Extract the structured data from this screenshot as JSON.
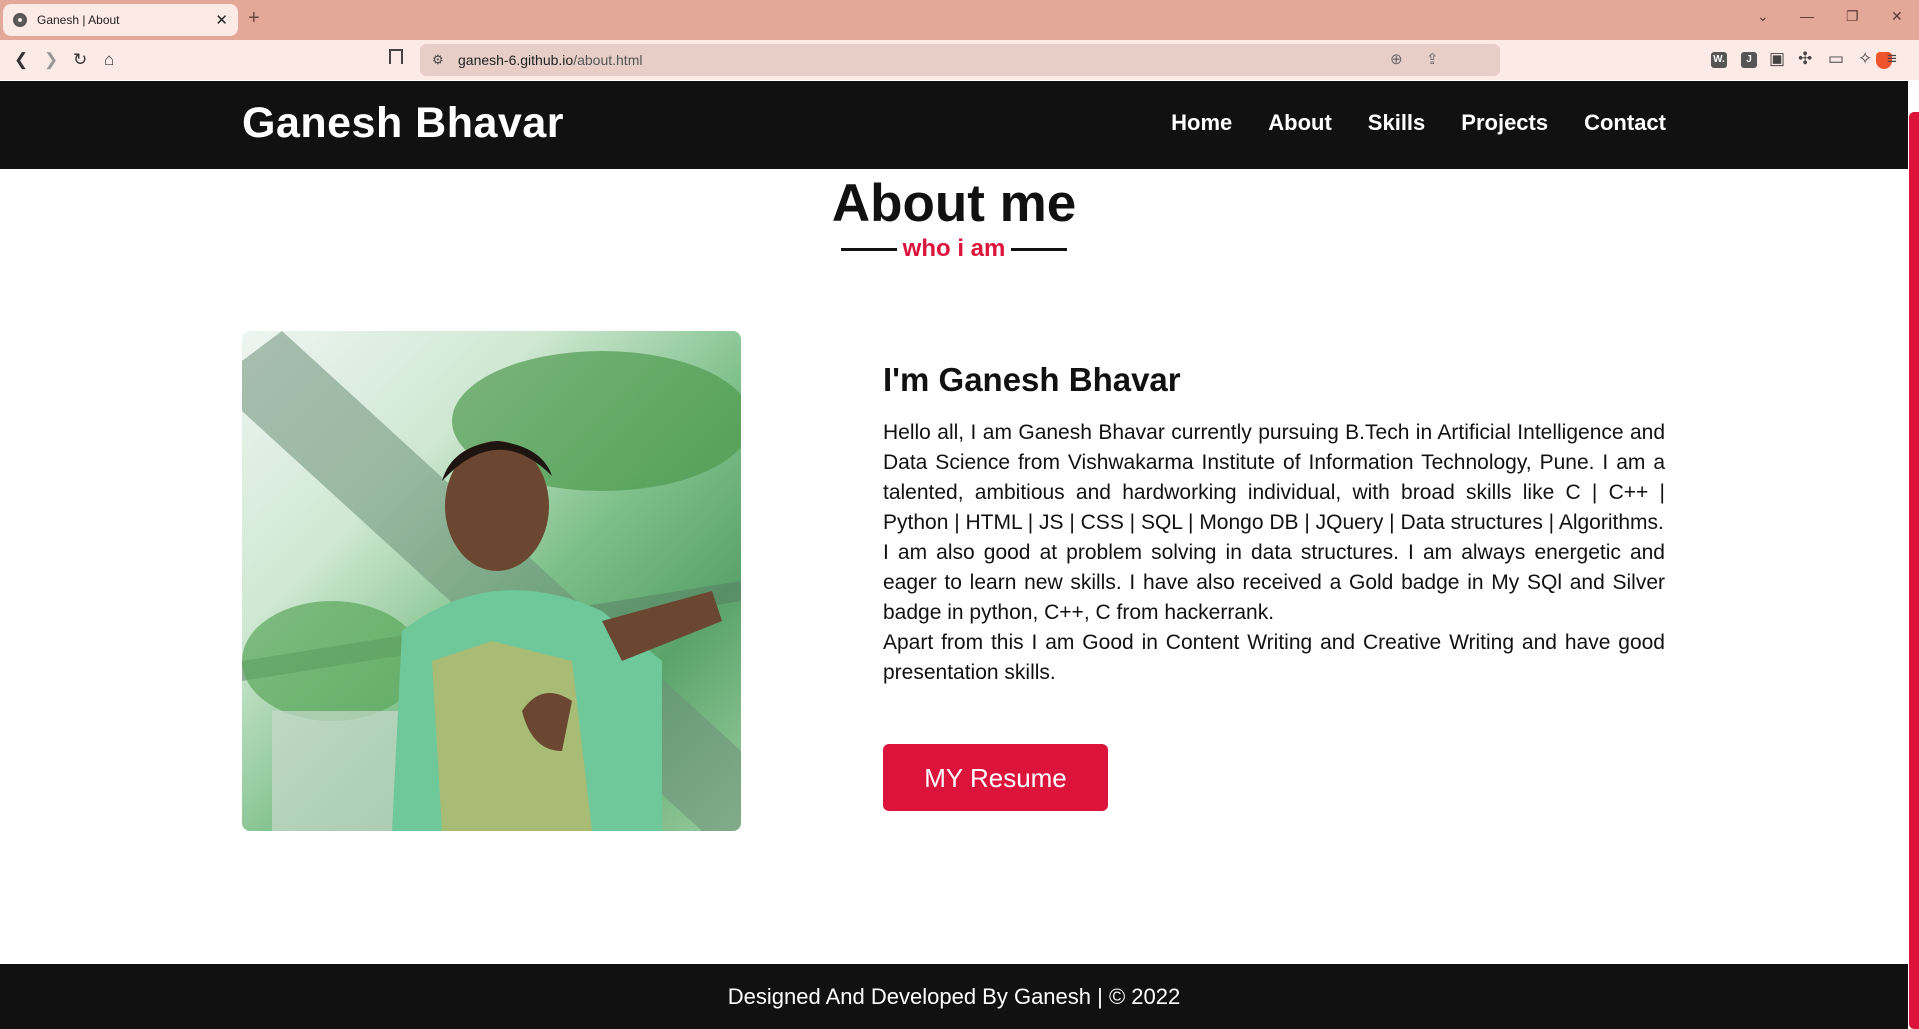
{
  "browser": {
    "tab_title": "Ganesh | About",
    "url_host": "ganesh-6.github.io",
    "url_path": "/about.html",
    "extensions": [
      "W.",
      "J"
    ]
  },
  "site": {
    "logo": "Ganesh Bhavar",
    "nav": [
      "Home",
      "About",
      "Skills",
      "Projects",
      "Contact"
    ]
  },
  "about": {
    "title": "About me",
    "subtitle": "who i am",
    "heading": "I'm Ganesh Bhavar",
    "paragraphs": [
      "Hello all, I am Ganesh Bhavar currently pursuing B.Tech in Artificial Intelligence and Data Science from Vishwakarma Institute of Information Technology, Pune. I am a talented, ambitious and hardworking individual, with broad skills like C | C++ | Python | HTML | JS | CSS | SQL | Mongo DB | JQuery | Data structures | Algorithms.",
      "I am also good at problem solving in data structures. I am always energetic and eager to learn new skills. I have also received a Gold badge in My SQl and Silver badge in python, C++, C from hackerrank.",
      "Apart from this I am Good in Content Writing and Creative Writing and have good presentation skills."
    ],
    "resume_button": "MY Resume"
  },
  "footer": {
    "text": "Designed And Developed By Ganesh | © 2022"
  },
  "colors": {
    "accent": "#dc143c",
    "nav_bg": "#111111",
    "tabbar_bg": "#e4a898"
  }
}
